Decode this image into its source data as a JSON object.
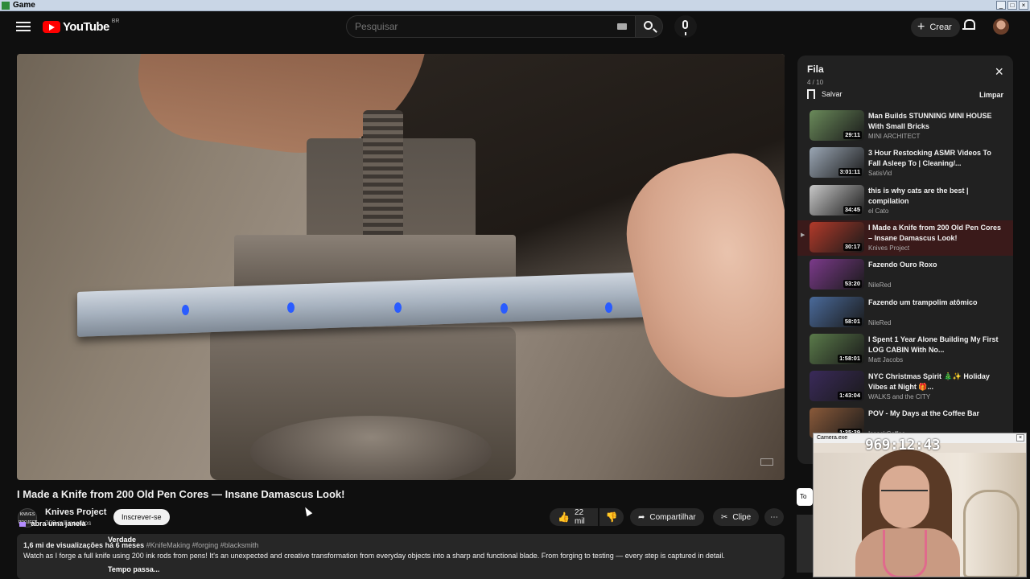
{
  "os": {
    "title": "Game",
    "controls": [
      "_",
      "□",
      "×"
    ]
  },
  "header": {
    "logo_text": "YouTube",
    "logo_country": "BR",
    "search_placeholder": "Pesquisar",
    "create_label": "Crear"
  },
  "video": {
    "title": "I Made a Knife from 200 Old Pen Cores — Insane Damascus Look!",
    "channel": "Knives Project",
    "channel_avatar_text": "KNIVES PROJECT",
    "subscribers": "300 mil inscritos",
    "subscribe_label": "Inscrever-se",
    "likes": "22 mil",
    "share_label": "Compartilhar",
    "clip_label": "Clipe",
    "more_label": "⋯"
  },
  "description": {
    "views": "1,6 mi de visualizações",
    "age": "há 6 meses",
    "tags": "#KnifeMaking #forging #blacksmith",
    "text": "Watch as I forge a full knife using 200 ink rods from pens! It's an unexpected and creative transformation from everyday objects into a sharp and functional blade. From forging to testing — every step is captured in detail."
  },
  "overlay": {
    "line1_text": "abra uma janela",
    "line2_text": "Verdade",
    "line3_text": "Tempo passa..."
  },
  "queue": {
    "title": "Fila",
    "count": "4 / 10",
    "save_label": "Salvar",
    "clear_label": "Limpar",
    "items": [
      {
        "title": "Man Builds STUNNING MINI HOUSE With Small Bricks",
        "channel": "MINI ARCHITECT",
        "duration": "29:11",
        "color": "#6a8a5a",
        "active": false
      },
      {
        "title": "3 Hour Restocking ASMR Videos To Fall Asleep To | Cleaning/...",
        "channel": "SatisVid",
        "duration": "3:01:11",
        "color": "#9aa6b4",
        "active": false
      },
      {
        "title": "this is why cats are the best | compilation",
        "channel": "el Cato",
        "duration": "34:45",
        "color": "#c8c8c8",
        "active": false
      },
      {
        "title": "I Made a Knife from 200 Old Pen Cores – Insane Damascus Look!",
        "channel": "Knives Project",
        "duration": "30:17",
        "color": "#b23a2a",
        "active": true
      },
      {
        "title": "Fazendo Ouro Roxo",
        "channel": "NileRed",
        "duration": "53:20",
        "color": "#7b3a8a",
        "active": false
      },
      {
        "title": "Fazendo um trampolim atômico",
        "channel": "NileRed",
        "duration": "58:01",
        "color": "#4a6a9a",
        "active": false
      },
      {
        "title": "I Spent 1 Year Alone Building My First LOG CABIN With No...",
        "channel": "Matt Jacobs",
        "duration": "1:58:01",
        "color": "#5a7a4a",
        "active": false
      },
      {
        "title": "NYC Christmas Spirit 🎄✨ Holiday Vibes at Night 🎁...",
        "channel": "WALKS and the CITY",
        "duration": "1:43:04",
        "color": "#3a2a5a",
        "active": false
      },
      {
        "title": "POV - My Days at the Coffee Bar",
        "channel": "IssackCoffee",
        "duration": "1:35:39",
        "color": "#8a5a3a",
        "active": false
      }
    ]
  },
  "webcam": {
    "title_bar": "Camera.exe",
    "timer": "969:12:43"
  },
  "side_tab_label": "To"
}
